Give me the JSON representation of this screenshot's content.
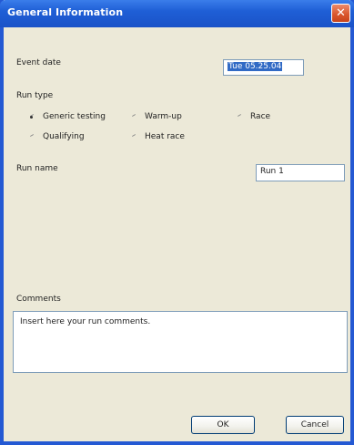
{
  "window": {
    "title": "General Information",
    "close_glyph": "✕"
  },
  "event_date": {
    "label": "Event date",
    "value": "Tue 05.25.04"
  },
  "run_type": {
    "label": "Run type",
    "selected": "Generic testing",
    "options": [
      "Generic testing",
      "Warm-up",
      "Race",
      "Qualifying",
      "Heat race"
    ]
  },
  "run_name": {
    "label": "Run name",
    "value": "Run 1"
  },
  "comments": {
    "label": "Comments",
    "value": "Insert here your run comments."
  },
  "buttons": {
    "ok": "OK",
    "cancel": "Cancel"
  }
}
